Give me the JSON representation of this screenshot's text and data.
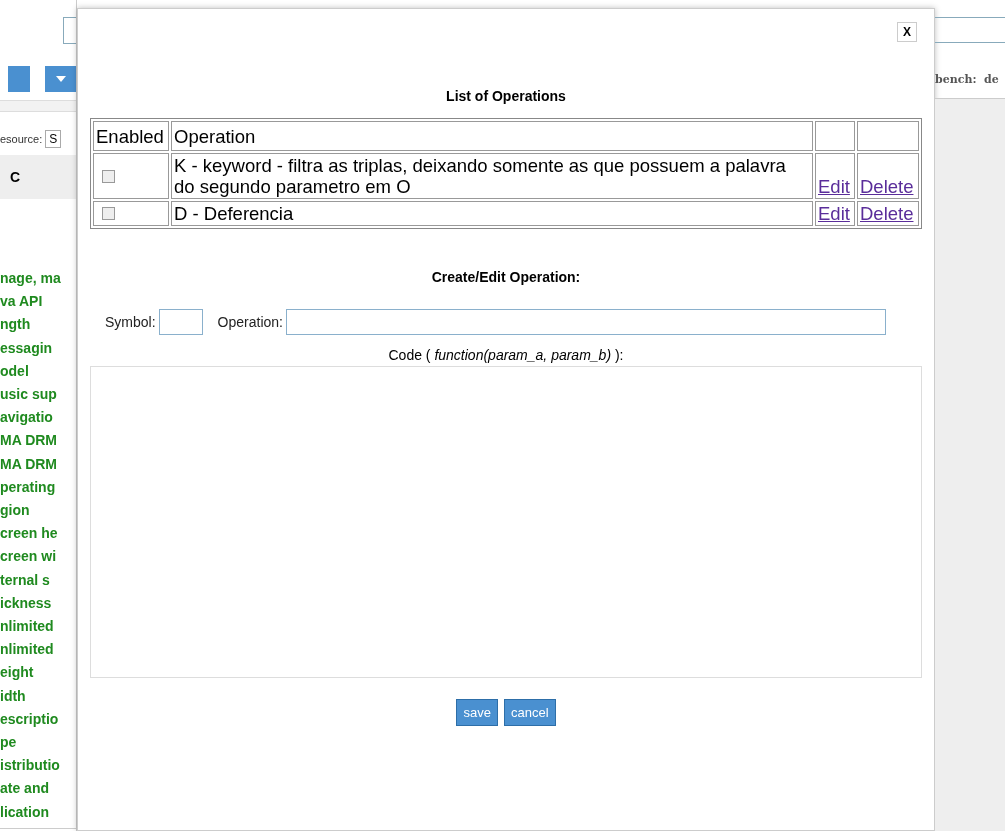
{
  "background": {
    "resource_label": "esource:",
    "resource_select": "S",
    "column_header": "C",
    "items": [
      "nage, ma",
      "va API",
      "ngth",
      "essagin",
      "odel",
      "usic sup",
      "avigatio",
      "MA DRM",
      "MA DRM",
      "perating",
      "gion",
      "creen he",
      "creen wi",
      "ternal s",
      "ickness",
      "nlimited",
      "nlimited",
      "eight",
      "idth",
      "escriptio",
      "pe",
      "istributio",
      "ate and",
      "lication"
    ],
    "right_label": "bench:  de"
  },
  "dialog": {
    "close": "X",
    "title": "List of Operations",
    "table": {
      "columns": [
        "Enabled",
        "Operation"
      ],
      "rows": [
        {
          "checked": false,
          "operation": "K - keyword - filtra as triplas, deixando somente as que possuem a palavra do segundo parametro em O",
          "edit": "Edit",
          "delete": "Delete"
        },
        {
          "checked": false,
          "operation": "D - Deferencia",
          "edit": "Edit",
          "delete": "Delete"
        }
      ]
    },
    "form_title": "Create/Edit Operation:",
    "symbol_label": "Symbol:",
    "operation_label": "Operation:",
    "code_label": "Code ( *function(param_a, param_b)* ):",
    "buttons": [
      "save",
      "cancel"
    ]
  }
}
